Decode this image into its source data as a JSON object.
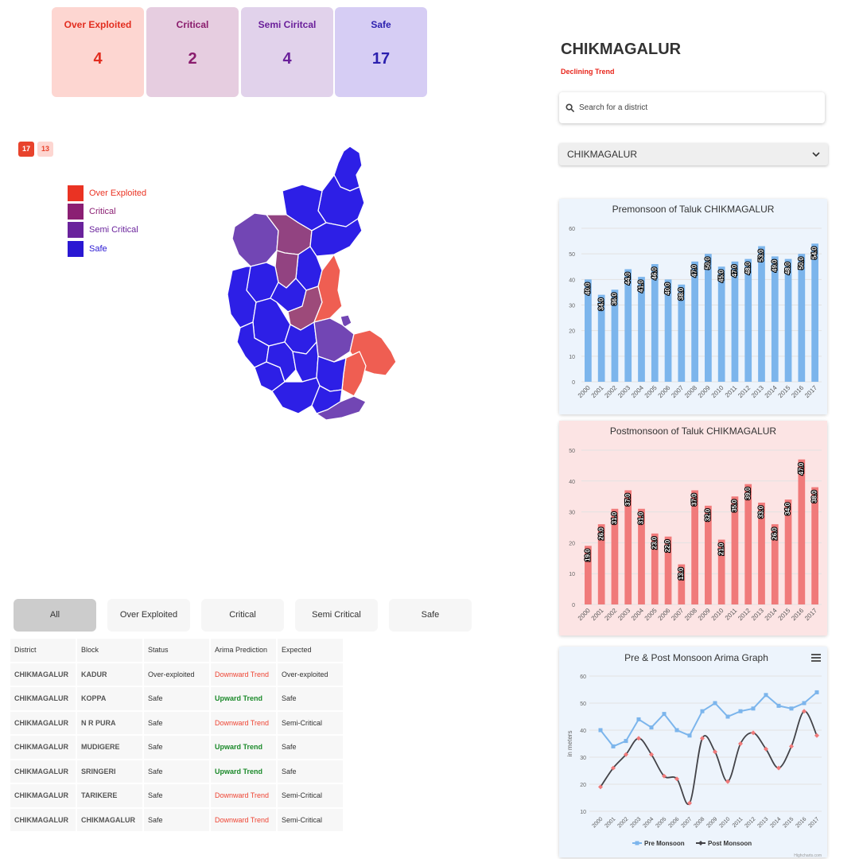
{
  "summary": [
    {
      "label": "Over Exploited",
      "count": "4",
      "bg": "#fdd6d1",
      "color": "#e22d1f"
    },
    {
      "label": "Critical",
      "count": "2",
      "bg": "#e6cde0",
      "color": "#8a1c6d"
    },
    {
      "label": "Semi Ciritcal",
      "count": "4",
      "bg": "#e1d2eb",
      "color": "#6a1f9a"
    },
    {
      "label": "Safe",
      "count": "17",
      "bg": "#d6cdf4",
      "color": "#2b1fae"
    }
  ],
  "pager": [
    "17",
    "13"
  ],
  "legend": [
    {
      "label": "Over Exploited",
      "color": "#ea3323"
    },
    {
      "label": "Critical",
      "color": "#8b1f73"
    },
    {
      "label": "Semi Critical",
      "color": "#6a239c"
    },
    {
      "label": "Safe",
      "color": "#2a18d3"
    }
  ],
  "tabs": [
    "All",
    "Over Exploited",
    "Critical",
    "Semi Critical",
    "Safe"
  ],
  "table": {
    "headers": [
      "District",
      "Block",
      "Status",
      "Arima Prediction",
      "Expected"
    ],
    "rows": [
      [
        "CHIKMAGALUR",
        "KADUR",
        "Over-exploited",
        "Downward Trend",
        "Over-exploited"
      ],
      [
        "CHIKMAGALUR",
        "KOPPA",
        "Safe",
        "Upward Trend",
        "Safe"
      ],
      [
        "CHIKMAGALUR",
        "N R PURA",
        "Safe",
        "Downward Trend",
        "Semi-Critical"
      ],
      [
        "CHIKMAGALUR",
        "MUDIGERE",
        "Safe",
        "Upward Trend",
        "Safe"
      ],
      [
        "CHIKMAGALUR",
        "SRINGERI",
        "Safe",
        "Upward Trend",
        "Safe"
      ],
      [
        "CHIKMAGALUR",
        "TARIKERE",
        "Safe",
        "Downward Trend",
        "Semi-Critical"
      ],
      [
        "CHIKMAGALUR",
        "CHIKMAGALUR",
        "Safe",
        "Downward Trend",
        "Semi-Critical"
      ]
    ]
  },
  "district": {
    "name": "CHIKMAGALUR",
    "trend": "Declining Trend",
    "search_placeholder": "Search for a district",
    "selected": "CHIKMAGALUR"
  },
  "chart_data": [
    {
      "type": "bar",
      "title": "Premonsoon of Taluk CHIKMAGALUR",
      "categories": [
        "2000",
        "2001",
        "2002",
        "2003",
        "2004",
        "2005",
        "2006",
        "2007",
        "2008",
        "2009",
        "2010",
        "2011",
        "2012",
        "2013",
        "2014",
        "2015",
        "2016",
        "2017"
      ],
      "values": [
        40,
        34,
        36,
        44,
        41,
        46,
        40,
        38,
        47,
        50,
        45,
        47,
        48,
        53,
        49,
        48,
        50,
        54
      ],
      "data_labels": [
        "40.0",
        "34.0",
        "36.0",
        "44.0",
        "41.0",
        "46.0",
        "40.0",
        "38.0",
        "47.0",
        "50.0",
        "45.0",
        "47.0",
        "48.0",
        "53.0",
        "49.0",
        "48.0",
        "50.0",
        "54.0"
      ],
      "yticks": [
        0,
        10,
        20,
        30,
        40,
        50,
        60
      ],
      "ylim": [
        0,
        60
      ],
      "color": "#7cb5ec",
      "bg": "#edf4fc"
    },
    {
      "type": "bar",
      "title": "Postmonsoon of Taluk CHIKMAGALUR",
      "categories": [
        "2000",
        "2001",
        "2002",
        "2003",
        "2004",
        "2005",
        "2006",
        "2007",
        "2008",
        "2009",
        "2010",
        "2011",
        "2012",
        "2013",
        "2014",
        "2015",
        "2016",
        "2017"
      ],
      "values": [
        19,
        26,
        31,
        37,
        31,
        23,
        22,
        13,
        37,
        32,
        21,
        35,
        39,
        33,
        26,
        34,
        47,
        38
      ],
      "data_labels": [
        "19.0",
        "26.0",
        "31.0",
        "37.0",
        "31.0",
        "23.0",
        "22.0",
        "13.0",
        "37.0",
        "32.0",
        "21.0",
        "35.0",
        "39.0",
        "33.0",
        "26.0",
        "34.0",
        "47.0",
        "38.0"
      ],
      "yticks": [
        0,
        10,
        20,
        30,
        40,
        50
      ],
      "ylim": [
        0,
        50
      ],
      "color": "#f07a7a",
      "bg": "#fce4e4"
    },
    {
      "type": "line",
      "title": "Pre & Post Monsoon Arima Graph",
      "ylabel": "in meters",
      "categories": [
        "2000",
        "2001",
        "2002",
        "2003",
        "2004",
        "2005",
        "2006",
        "2007",
        "2008",
        "2009",
        "2010",
        "2011",
        "2012",
        "2013",
        "2014",
        "2015",
        "2016",
        "2017"
      ],
      "yticks": [
        10,
        20,
        30,
        40,
        50,
        60
      ],
      "ylim": [
        10,
        60
      ],
      "series": [
        {
          "name": "Pre Monsoon",
          "color": "#7cb5ec",
          "values": [
            40,
            34,
            36,
            44,
            41,
            46,
            40,
            38,
            47,
            50,
            45,
            47,
            48,
            53,
            49,
            48,
            50,
            54
          ]
        },
        {
          "name": "Post Monsoon",
          "color": "#434348",
          "marker_color": "#f07a7a",
          "values": [
            19,
            26,
            31,
            37,
            31,
            23,
            22,
            13,
            37,
            32,
            21,
            35,
            39,
            33,
            26,
            34,
            47,
            38
          ]
        }
      ],
      "credit": "Highcharts.com",
      "bg": "#edf4fc"
    }
  ]
}
